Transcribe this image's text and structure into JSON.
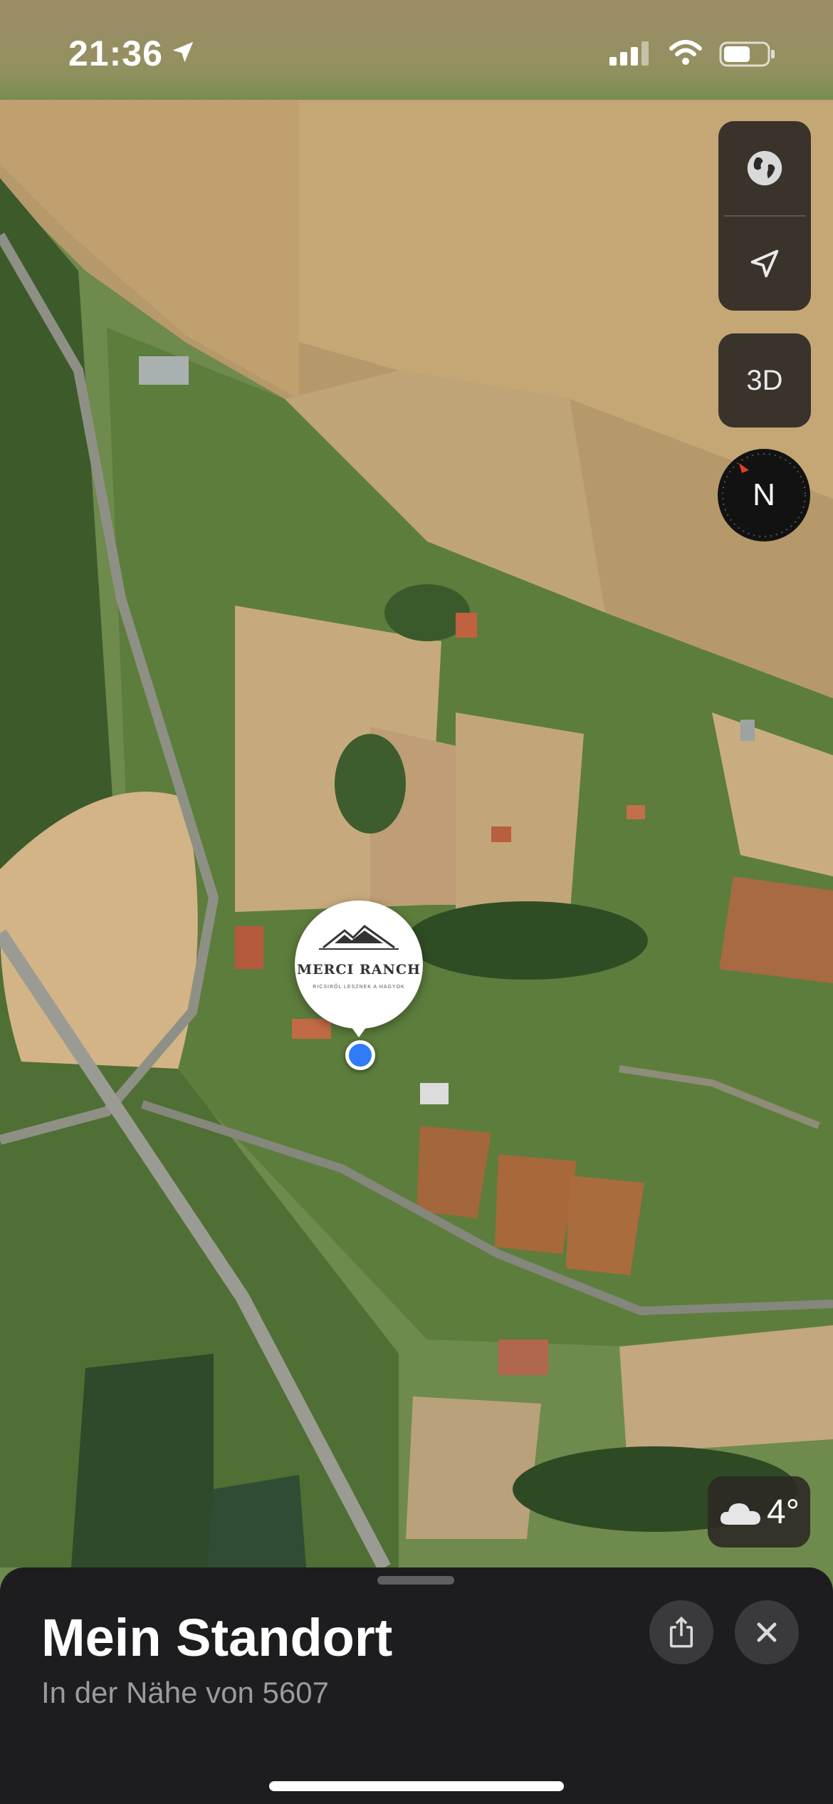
{
  "status_bar": {
    "time": "21:36",
    "icons": [
      "location-arrow-icon",
      "cellular-signal-icon",
      "wifi-icon",
      "battery-icon"
    ]
  },
  "map": {
    "view": "satellite",
    "controls": {
      "globe": "globe-icon",
      "locate": "location-arrow-icon",
      "three_d_label": "3D",
      "compass_label": "N"
    },
    "weather": {
      "icon": "cloud-icon",
      "temperature": "4°"
    },
    "poi": {
      "name": "MERCI RANCH",
      "subtitle": "RICSIRŐL LESZNEK A HAGYOK"
    }
  },
  "sheet": {
    "title": "Mein Standort",
    "subtitle": "In der Nähe von 5607",
    "share_icon": "share-icon",
    "close_icon": "close-icon"
  },
  "colors": {
    "sheet_background": "#1d1d1f",
    "user_location": "#2f7cf6",
    "control_background": "#2c2926",
    "compass_accent": "#e23b2e"
  }
}
